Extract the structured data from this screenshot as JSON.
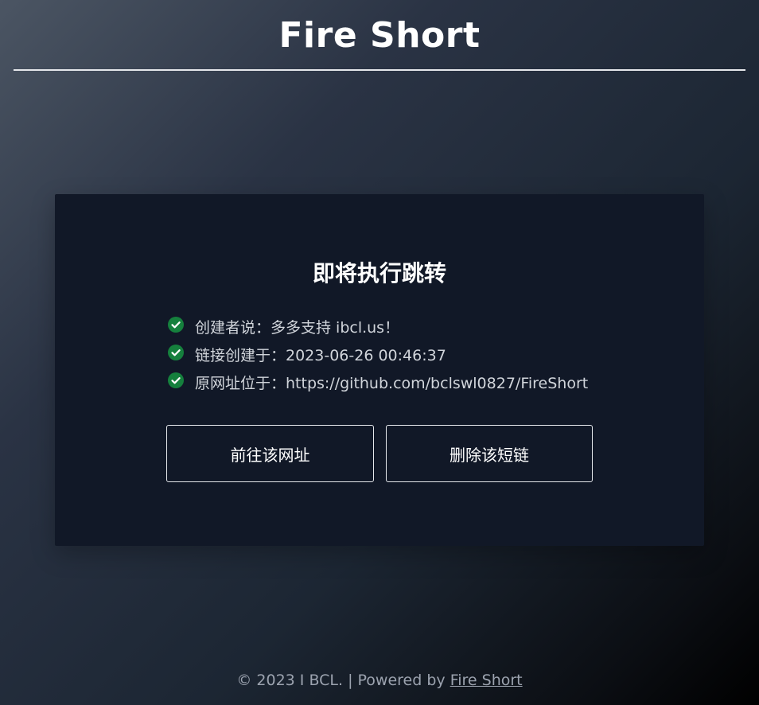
{
  "header": {
    "title": "Fire Short"
  },
  "card": {
    "title": "即将执行跳转",
    "items": [
      {
        "icon": "check-circle-icon",
        "text": "创建者说：多多支持 ibcl.us！"
      },
      {
        "icon": "check-circle-icon",
        "text": "链接创建于：2023-06-26 00:46:37"
      },
      {
        "icon": "check-circle-icon",
        "text": "原网址位于：https://github.com/bclswl0827/FireShort"
      }
    ],
    "buttons": {
      "visit_label": "前往该网址",
      "delete_label": "删除该短链"
    }
  },
  "footer": {
    "prefix": "© 2023 I BCL. | Powered by ",
    "link_text": "Fire Short"
  },
  "colors": {
    "check_icon": "#15803d",
    "card_background": "#111827",
    "footer_text": "#9ca3af"
  }
}
